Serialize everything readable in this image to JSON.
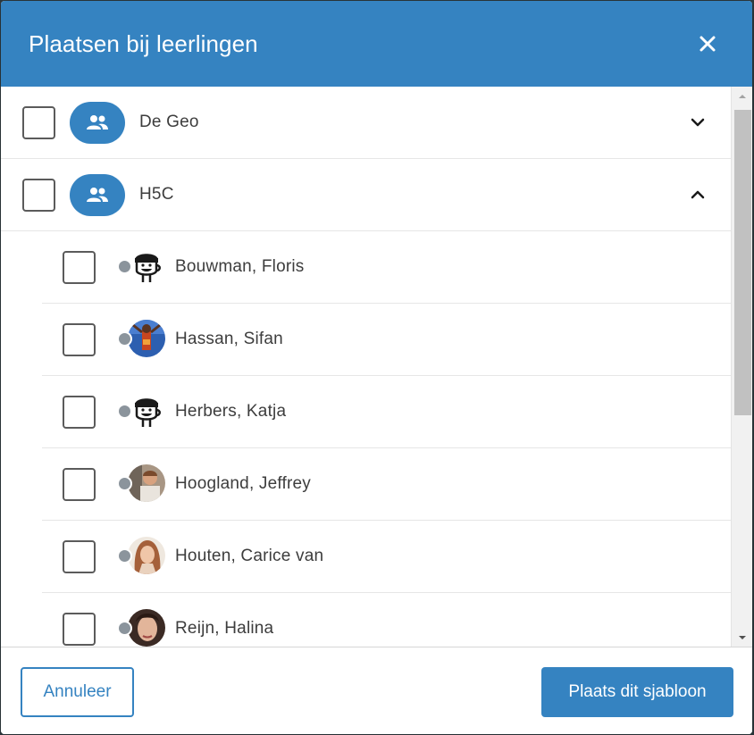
{
  "modal": {
    "title": "Plaatsen bij leerlingen",
    "close_icon": "close-icon"
  },
  "groups": [
    {
      "label": "De Geo",
      "expanded": false,
      "icon": "group-icon",
      "chevron": "chevron-down-icon"
    },
    {
      "label": "H5C",
      "expanded": true,
      "icon": "group-icon",
      "chevron": "chevron-up-icon"
    }
  ],
  "students": [
    {
      "name": "Bouwman, Floris",
      "avatar": "cartoon-face",
      "status": "offline"
    },
    {
      "name": "Hassan, Sifan",
      "avatar": "photo",
      "status": "offline"
    },
    {
      "name": "Herbers, Katja",
      "avatar": "cartoon-face",
      "status": "offline"
    },
    {
      "name": "Hoogland, Jeffrey",
      "avatar": "photo",
      "status": "offline"
    },
    {
      "name": "Houten, Carice van",
      "avatar": "photo",
      "status": "offline"
    },
    {
      "name": "Reijn, Halina",
      "avatar": "photo",
      "status": "offline"
    }
  ],
  "footer": {
    "cancel_label": "Annuleer",
    "confirm_label": "Plaats dit sjabloon"
  },
  "colors": {
    "primary": "#3583c1",
    "status_offline": "#8b949c"
  }
}
